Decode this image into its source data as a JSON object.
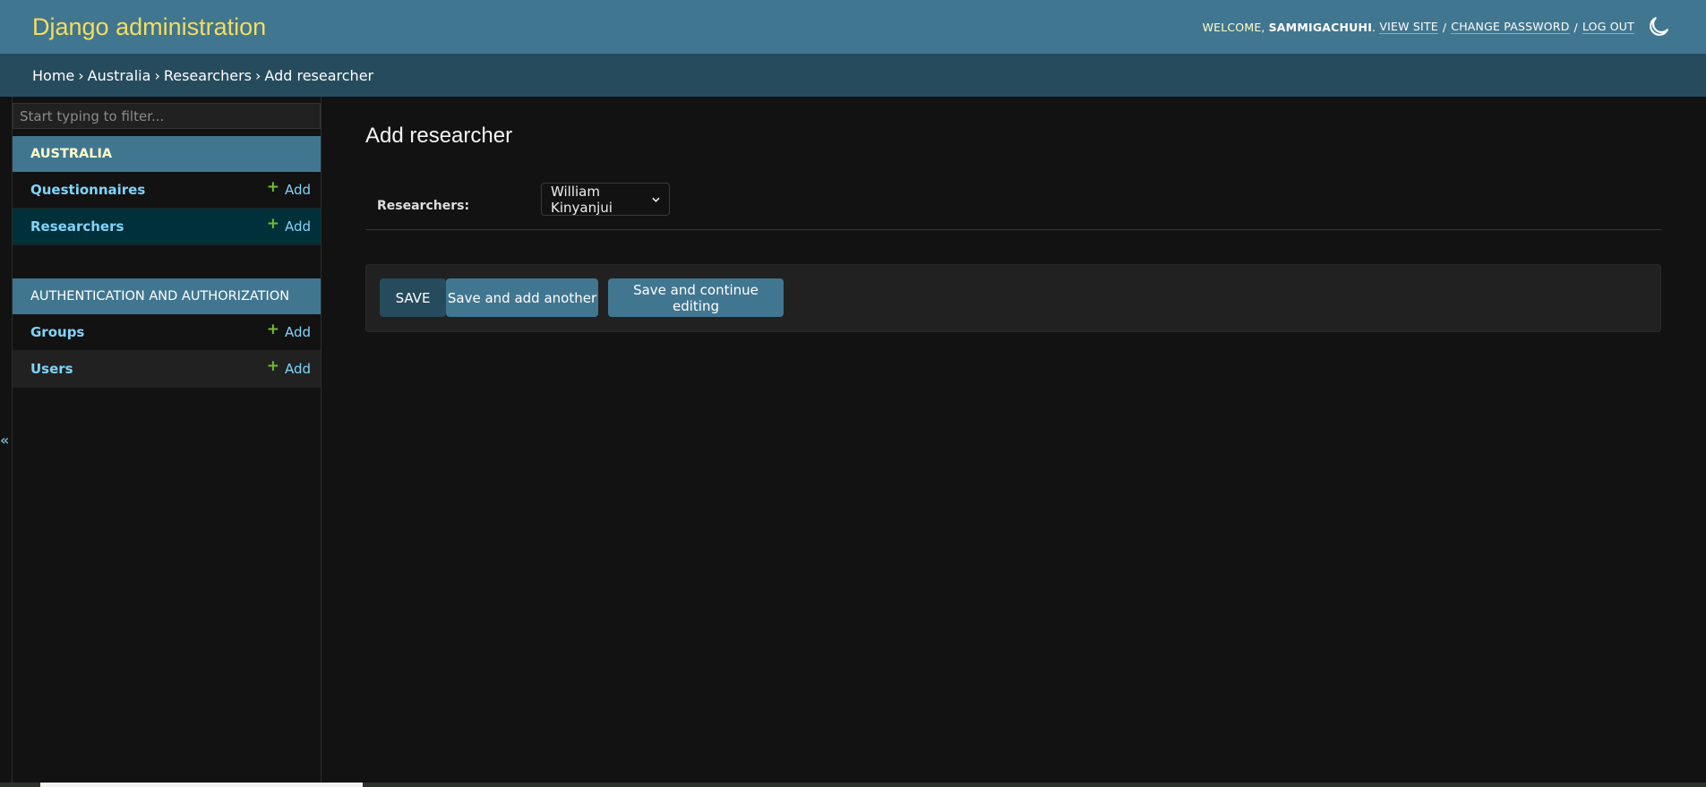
{
  "header": {
    "title": "Django administration",
    "welcome": "Welcome,",
    "username": "sammigachuhi",
    "links": [
      "View site",
      "Change password",
      "Log out"
    ],
    "theme_icon": "moon-icon"
  },
  "breadcrumbs": [
    "Home",
    "Australia",
    "Researchers",
    "Add researcher"
  ],
  "sidebar": {
    "filter_placeholder": "Start typing to filter...",
    "collapse_icon": "«",
    "modules": [
      {
        "title": "Australia",
        "items": [
          {
            "label": "Questionnaires",
            "add": "Add"
          },
          {
            "label": "Researchers",
            "add": "Add",
            "current": true
          }
        ]
      },
      {
        "title": "Authentication and Authorization",
        "items": [
          {
            "label": "Groups",
            "add": "Add"
          },
          {
            "label": "Users",
            "add": "Add"
          }
        ]
      }
    ]
  },
  "main": {
    "title": "Add researcher",
    "field_label": "Researchers:",
    "field_value": "William Kinyanjui",
    "buttons": {
      "save": "SAVE",
      "save_add": "Save and add another",
      "save_continue": "Save and continue editing"
    }
  },
  "colors": {
    "header": "#417690",
    "breadcrumbs": "#264b5d",
    "brand": "#f5dd5d",
    "link": "#81d4fa",
    "add_plus": "#70bf2b"
  }
}
